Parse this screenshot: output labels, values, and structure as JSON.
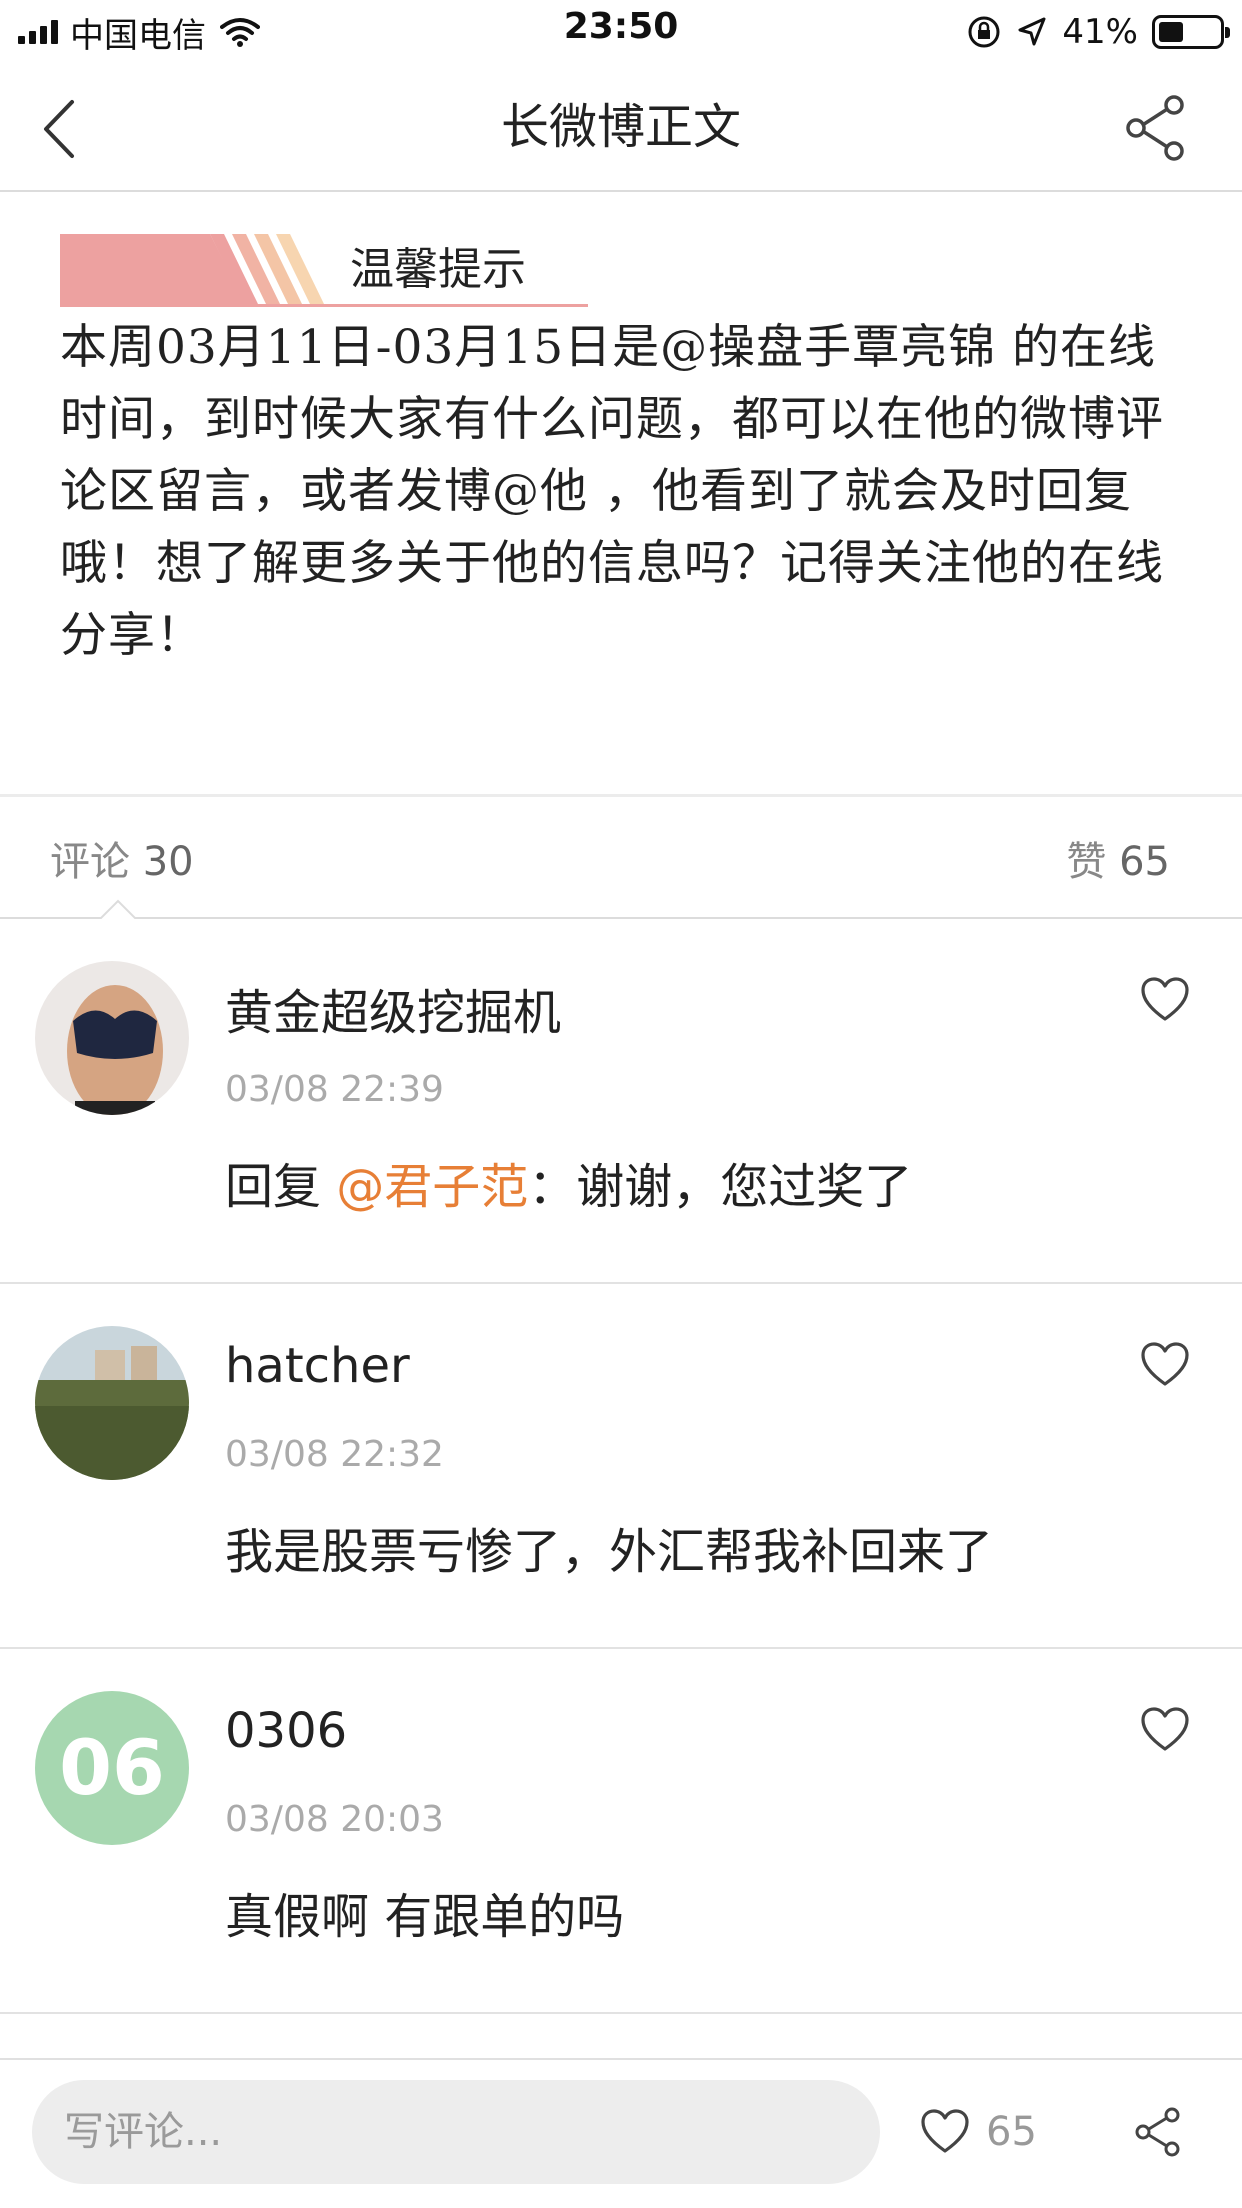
{
  "status_bar": {
    "carrier": "中国电信",
    "time": "23:50",
    "battery": "41%",
    "battery_level": 0.41
  },
  "nav": {
    "title": "长微博正文"
  },
  "article": {
    "tip_label": "温馨提示",
    "body": "本周03月11日-03月15日是@操盘手覃亮锦 的在线时间，到时候大家有什么问题，都可以在他的微博评论区留言，或者发博@他 ，他看到了就会及时回复哦！想了解更多关于他的信息吗？记得关注他的在线分享！"
  },
  "counts": {
    "comments_label": "评论",
    "comments_count": "30",
    "likes_label": "赞",
    "likes_count": "65"
  },
  "comments": [
    {
      "name": "黄金超级挖掘机",
      "time": "03/08 22:39",
      "reply_prefix": "回复 ",
      "mention": "@君子范",
      "text": "：谢谢，您过奖了"
    },
    {
      "name": "hatcher",
      "time": "03/08 22:32",
      "text": "我是股票亏惨了，外汇帮我补回来了"
    },
    {
      "avatar_text": "06",
      "name": "0306",
      "time": "03/08 20:03",
      "text": "真假啊 有跟单的吗"
    }
  ],
  "bottom_bar": {
    "comment_placeholder": "写评论...",
    "like_count": "65"
  },
  "colors": {
    "accent_orange": "#e77f36",
    "tip_pink": "#eda1a0",
    "avatar_green": "#a6d7b0"
  }
}
